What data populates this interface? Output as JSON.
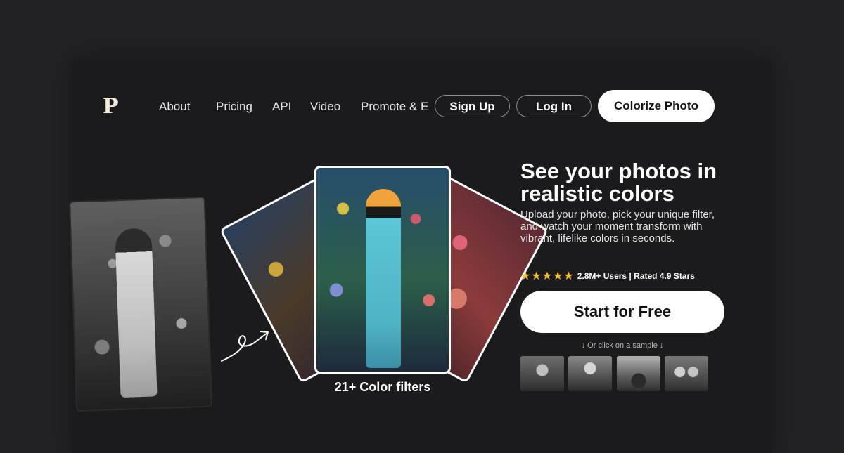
{
  "brand": {
    "logo_letter": "P"
  },
  "nav": {
    "links": [
      "About",
      "Pricing",
      "API",
      "Video",
      "Promote & E"
    ]
  },
  "header_buttons": {
    "sign_up": "Sign Up",
    "log_in": "Log In",
    "colorize": "Colorize Photo"
  },
  "hero": {
    "filters_label": "21+ Color filters",
    "headline": "See your photos in realistic colors",
    "subtext": "Upload your photo, pick your unique filter, and watch your moment transform with vibrant, lifelike colors in seconds.",
    "stars": "★★★★★",
    "rating_text": "2.8M+ Users | Rated 4.9 Stars",
    "cta": "Start for Free",
    "sample_hint": "↓ Or click on a sample ↓"
  },
  "icons": {
    "logo": "p-logo",
    "arrow": "curved-arrow-icon",
    "star": "star-icon"
  },
  "colors": {
    "background": "#222125",
    "panel": "#1b1a1c",
    "accent_star": "#f2c23a",
    "button_solid": "#ffffff"
  }
}
